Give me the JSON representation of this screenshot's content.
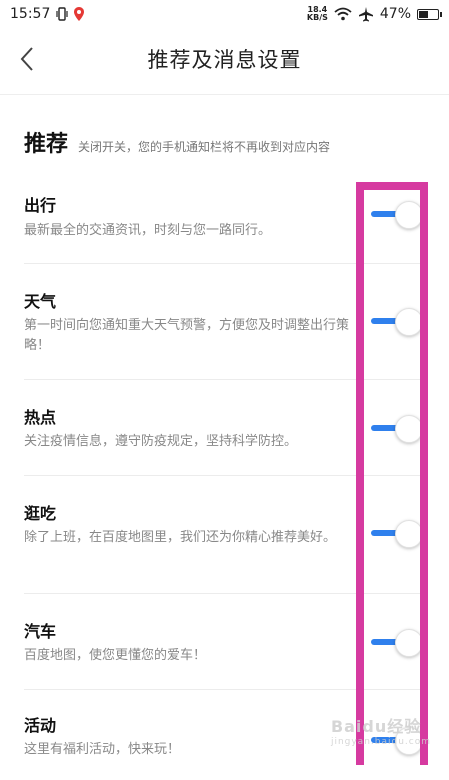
{
  "status_bar": {
    "time": "15:57",
    "net_speed_value": "18.4",
    "net_speed_unit": "KB/S",
    "battery": "47%",
    "battery_level": 0.47
  },
  "header": {
    "title": "推荐及消息设置"
  },
  "section": {
    "title": "推荐",
    "subtitle": "关闭开关，您的手机通知栏将不再收到对应内容"
  },
  "items": [
    {
      "title": "出行",
      "desc": "最新最全的交通资讯，时刻与您一路同行。",
      "enabled": true
    },
    {
      "title": "天气",
      "desc": "第一时间向您通知重大天气预警，方便您及时调整出行策略！",
      "enabled": true
    },
    {
      "title": "热点",
      "desc": "关注疫情信息，遵守防疫规定，坚持科学防控。",
      "enabled": true
    },
    {
      "title": "逛吃",
      "desc": "除了上班，在百度地图里，我们还为你精心推荐美好。",
      "enabled": true
    },
    {
      "title": "汽车",
      "desc": "百度地图，使您更懂您的爱车！",
      "enabled": true
    },
    {
      "title": "活动",
      "desc": "这里有福利活动，快来玩！",
      "enabled": true
    }
  ],
  "colors": {
    "toggle_on": "#2f80ed",
    "highlight": "#d63aa0"
  },
  "watermark": {
    "brand": "Baidu经验",
    "url": "jingyan.baidu.com"
  }
}
